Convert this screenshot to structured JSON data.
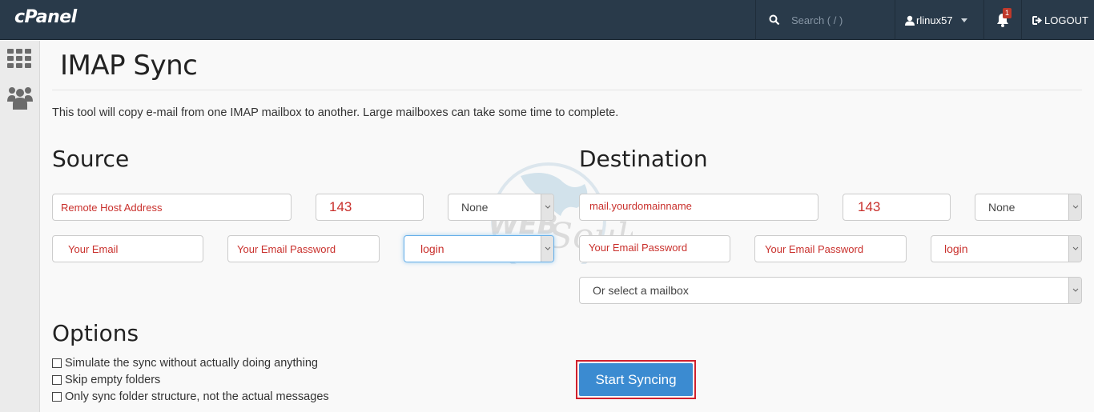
{
  "header": {
    "logo": "cPanel",
    "search_placeholder": "Search ( / )",
    "username": "rlinux57",
    "notification_count": "1",
    "logout_label": "LOGOUT"
  },
  "sidebar": {
    "items": [
      {
        "icon": "grid-icon",
        "label": "Tools"
      },
      {
        "icon": "users-icon",
        "label": "Users"
      }
    ]
  },
  "page": {
    "title": "IMAP Sync",
    "description": "This tool will copy e-mail from one IMAP mailbox to another. Large mailboxes can take some time to complete."
  },
  "source": {
    "heading": "Source",
    "host": "Remote Host Address",
    "port": "143",
    "encryption": "None",
    "email": "Your Email",
    "password": "Your Email Password",
    "auth": "login"
  },
  "destination": {
    "heading": "Destination",
    "host": "mail.yourdomainname",
    "port": "143",
    "encryption": "None",
    "email": "Your Email Password",
    "password": "Your Email Password",
    "auth": "login",
    "mailbox": "Or select a mailbox"
  },
  "options": {
    "heading": "Options",
    "items": [
      {
        "label": "Simulate the sync without actually doing anything",
        "checked": false
      },
      {
        "label": "Skip empty folders",
        "checked": false
      },
      {
        "label": "Only sync folder structure, not the actual messages",
        "checked": false
      }
    ]
  },
  "actions": {
    "start_label": "Start Syncing"
  },
  "watermark": {
    "text_top": "WEB",
    "text_bottom": "Souls"
  },
  "colors": {
    "topbar": "#293a4a",
    "field_text": "#c9302c",
    "primary_button": "#3b8bd1",
    "highlight_border": "#d0202d"
  }
}
